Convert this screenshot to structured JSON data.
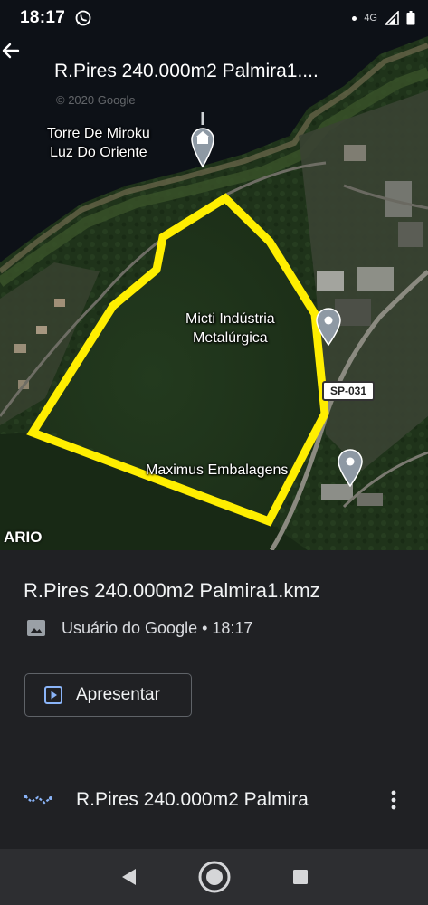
{
  "status_bar": {
    "time": "18:17",
    "network": "4G",
    "icons": [
      "whatsapp-icon",
      "notification-dot-icon",
      "signal-icon",
      "battery-icon"
    ]
  },
  "app_bar": {
    "title": "R.Pires 240.000m2 Palmira1....",
    "back_icon": "arrow-back-icon"
  },
  "map": {
    "type": "satellite",
    "watermark": "© 2020 Google",
    "places": [
      {
        "name": "Torre De Miroku\nLuz Do Oriente",
        "icon": "temple-pin-icon"
      },
      {
        "name": "Micti Indústria\nMetalúrgica",
        "icon": "location-pin-icon"
      },
      {
        "name": "Maximus Embalagens",
        "icon": "location-pin-icon"
      }
    ],
    "road_shield": "SP-031",
    "edge_label": "ARIO",
    "boundary_color": "#ffee00",
    "water_color": "#0d1117"
  },
  "sheet": {
    "file_title": "R.Pires 240.000m2 Palmira1.kmz",
    "meta": "Usuário do Google • 18:17",
    "meta_icon": "image-icon",
    "present_button": {
      "label": "Apresentar",
      "icon": "slideshow-icon"
    },
    "layer": {
      "name": "R.Pires 240.000m2 Palmira",
      "icon": "route-icon",
      "menu_icon": "more-vert-icon"
    }
  },
  "nav_bar": {
    "icons": [
      "back-triangle-icon",
      "home-circle-icon",
      "recents-square-icon"
    ]
  }
}
